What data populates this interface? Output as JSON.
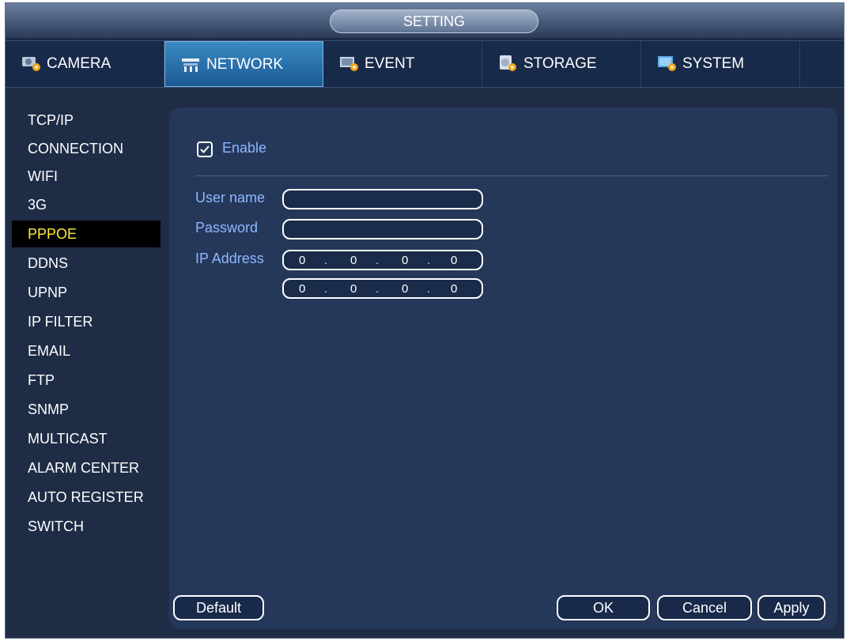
{
  "window": {
    "title": "SETTING"
  },
  "tabs": [
    {
      "label": "CAMERA",
      "icon": "camera-settings-icon"
    },
    {
      "label": "NETWORK",
      "icon": "network-settings-icon",
      "active": true
    },
    {
      "label": "EVENT",
      "icon": "event-settings-icon"
    },
    {
      "label": "STORAGE",
      "icon": "storage-settings-icon"
    },
    {
      "label": "SYSTEM",
      "icon": "system-settings-icon"
    }
  ],
  "sidebar": {
    "items": [
      {
        "label": "TCP/IP"
      },
      {
        "label": "CONNECTION"
      },
      {
        "label": "WIFI"
      },
      {
        "label": "3G"
      },
      {
        "label": "PPPOE",
        "active": true
      },
      {
        "label": "DDNS"
      },
      {
        "label": "UPNP"
      },
      {
        "label": "IP FILTER"
      },
      {
        "label": "EMAIL"
      },
      {
        "label": "FTP"
      },
      {
        "label": "SNMP"
      },
      {
        "label": "MULTICAST"
      },
      {
        "label": "ALARM CENTER"
      },
      {
        "label": "AUTO REGISTER"
      },
      {
        "label": "SWITCH"
      }
    ]
  },
  "form": {
    "enable_label": "Enable",
    "enable_checked": true,
    "username_label": "User name",
    "username_value": "",
    "password_label": "Password",
    "password_value": "",
    "ip_label": "IP Address",
    "ip1": [
      "0",
      "0",
      "0",
      "0"
    ],
    "ip2": [
      "0",
      "0",
      "0",
      "0"
    ]
  },
  "buttons": {
    "default": "Default",
    "ok": "OK",
    "cancel": "Cancel",
    "apply": "Apply"
  },
  "colors": {
    "active_tab": "#2a78b8",
    "active_sidebar_text": "#ffeb3b",
    "field_label": "#8fb7ff",
    "content_bg": "#25385a"
  }
}
